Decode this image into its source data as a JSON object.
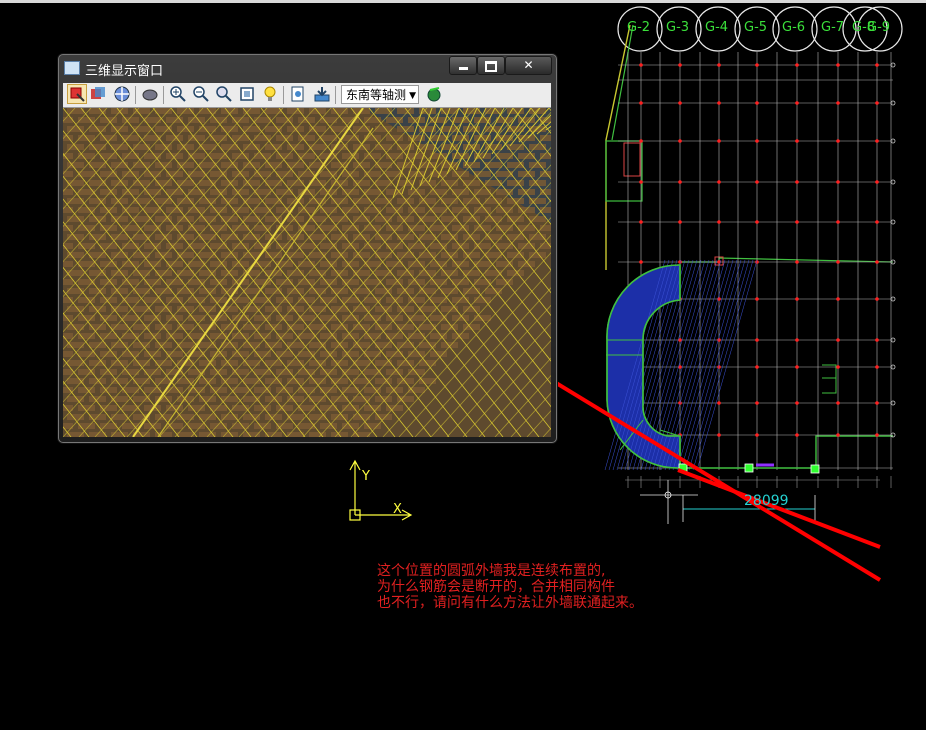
{
  "window_3d": {
    "title": "三维显示窗口",
    "view_select": "东南等轴测",
    "toolbar_icons": [
      "rotate-view-icon",
      "pan-icon",
      "orbit-icon",
      "refresh-icon",
      "zoom-in-icon",
      "zoom-out-icon",
      "zoom-window-icon",
      "zoom-extents-icon",
      "light-icon",
      "render-icon",
      "export-icon",
      "display-settings-icon"
    ]
  },
  "cad": {
    "dimension": "28099",
    "axis_x": "X",
    "axis_y": "Y",
    "grid_labels": [
      "G-2",
      "G-3",
      "G-4",
      "G-5",
      "G-6",
      "G-7",
      "G-8",
      "G-9"
    ]
  },
  "note_lines": [
    "这个位置的圆弧外墙我是连续布置的,",
    "为什么钢筋会是断开的，合并相同构件",
    "也不行，请问有什么方法让外墙联通起来。"
  ],
  "colors": {
    "background": "#000000",
    "grid_line": "#d0d0d0",
    "grid_point": "#ff2020",
    "wall_green": "#40c040",
    "arc_fill": "#1c2fa8",
    "annotation_red": "#ff0000",
    "dim_cyan": "#25d0d0",
    "axis_yellow": "#ffff40",
    "rebar_yellow": "#d8c830"
  }
}
